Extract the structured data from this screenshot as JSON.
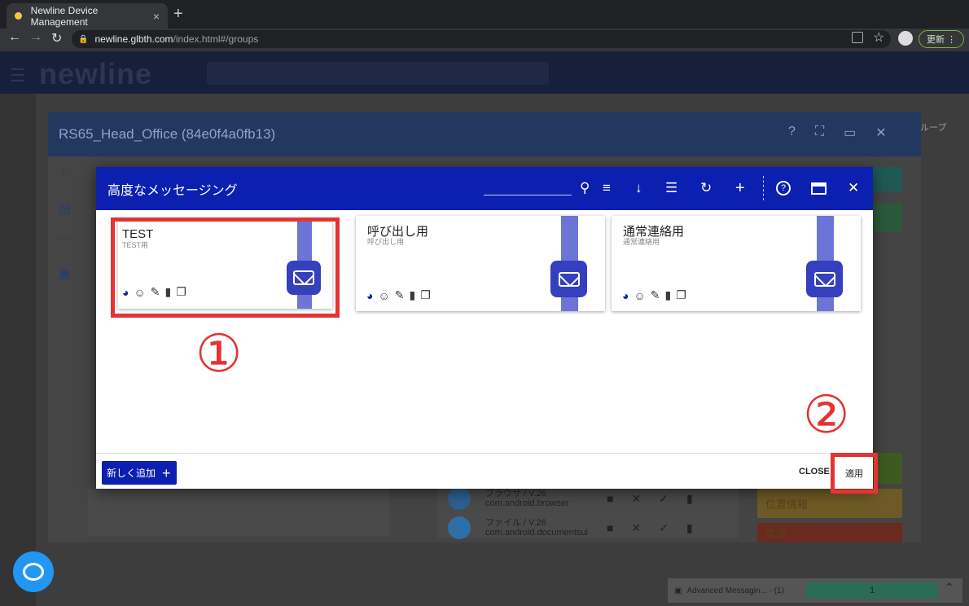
{
  "browser": {
    "tab_title": "Newline Device Management",
    "tab_close": "×",
    "new_tab": "+",
    "url_host": "newline.glbth.com",
    "url_path": "/index.html#/groups",
    "update_label": "更新 ⋮",
    "nav_back": "←",
    "nav_forward": "→",
    "nav_reload": "↻",
    "lock": "🔒"
  },
  "app": {
    "logo": "newline",
    "group_label": "ループ"
  },
  "device_dialog": {
    "title": "RS65_Head_Office (84e0f4a0fb13)",
    "icons": [
      "?",
      "⛶",
      "▭",
      "✕"
    ],
    "apps": [
      {
        "name": "ブラウザ / V.26",
        "pkg": "com.android.browser"
      },
      {
        "name": "ファイル / V.26",
        "pkg": "com.android.documentsui"
      }
    ],
    "right_buttons": [
      {
        "label": "位置情報",
        "color": "#6d5a26"
      },
      {
        "label": "電源",
        "color": "#6a2a1d"
      }
    ]
  },
  "modal": {
    "title": "高度なメッセージング",
    "search_value": "",
    "cards": [
      {
        "title": "TEST",
        "subtitle": "TEST用"
      },
      {
        "title": "呼び出し用",
        "subtitle": "呼び出し用"
      },
      {
        "title": "通常連絡用",
        "subtitle": "通常連絡用"
      }
    ],
    "add_new_label": "新しく追加",
    "add_plus": "+",
    "close_label": "CLOSE",
    "apply_label": "適用"
  },
  "annotations": {
    "marker1": "①",
    "marker2": "②",
    "highlight_color": "#e53333"
  },
  "taskbar": {
    "item": "Advanced Messagin... - (1)",
    "progress_label": "1"
  }
}
